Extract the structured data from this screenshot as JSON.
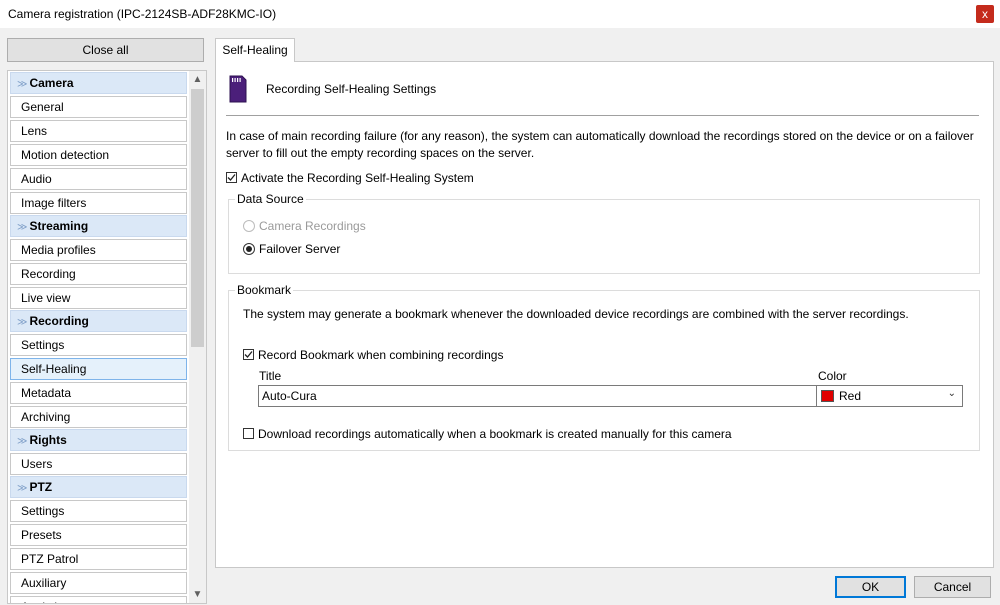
{
  "window": {
    "title": "Camera registration (IPC-2124SB-ADF28KMC-IO)",
    "close_glyph": "x"
  },
  "sidebar": {
    "close_all_label": "Close all",
    "groups": [
      {
        "label": "Camera",
        "items": [
          "General",
          "Lens",
          "Motion detection",
          "Audio",
          "Image filters"
        ]
      },
      {
        "label": "Streaming",
        "items": [
          "Media profiles",
          "Recording",
          "Live view"
        ]
      },
      {
        "label": "Recording",
        "items": [
          "Settings",
          "Self-Healing",
          "Metadata",
          "Archiving"
        ]
      },
      {
        "label": "Rights",
        "items": [
          "Users"
        ]
      },
      {
        "label": "PTZ",
        "items": [
          "Settings",
          "Presets",
          "PTZ Patrol",
          "Auxiliary",
          "Analytics"
        ]
      }
    ],
    "selected": "Self-Healing"
  },
  "tab": {
    "label": "Self-Healing"
  },
  "content": {
    "header_title": "Recording Self-Healing Settings",
    "description": "In case of main recording failure (for any reason), the system can automatically download the recordings stored on the device or on a failover server to fill out the empty recording spaces on the server.",
    "activate_label": "Activate the Recording Self-Healing System",
    "activate_checked": true,
    "data_source": {
      "legend": "Data Source",
      "option_camera": "Camera Recordings",
      "option_failover": "Failover Server",
      "selected": "Failover Server"
    },
    "bookmark": {
      "legend": "Bookmark",
      "description": "The system may generate a bookmark whenever the downloaded device recordings are combined with the server recordings.",
      "record_label": "Record Bookmark when combining recordings",
      "record_checked": true,
      "title_label": "Title",
      "title_value": "Auto-Cura",
      "color_label": "Color",
      "color_value": "Red",
      "color_hex": "#e00000",
      "download_label": "Download recordings automatically when a bookmark is created manually for this camera",
      "download_checked": false
    }
  },
  "buttons": {
    "ok": "OK",
    "cancel": "Cancel"
  },
  "icons": {
    "header": "sd-card-icon",
    "scroll_up": "chevron-up-icon",
    "scroll_down": "chevron-down-icon"
  }
}
